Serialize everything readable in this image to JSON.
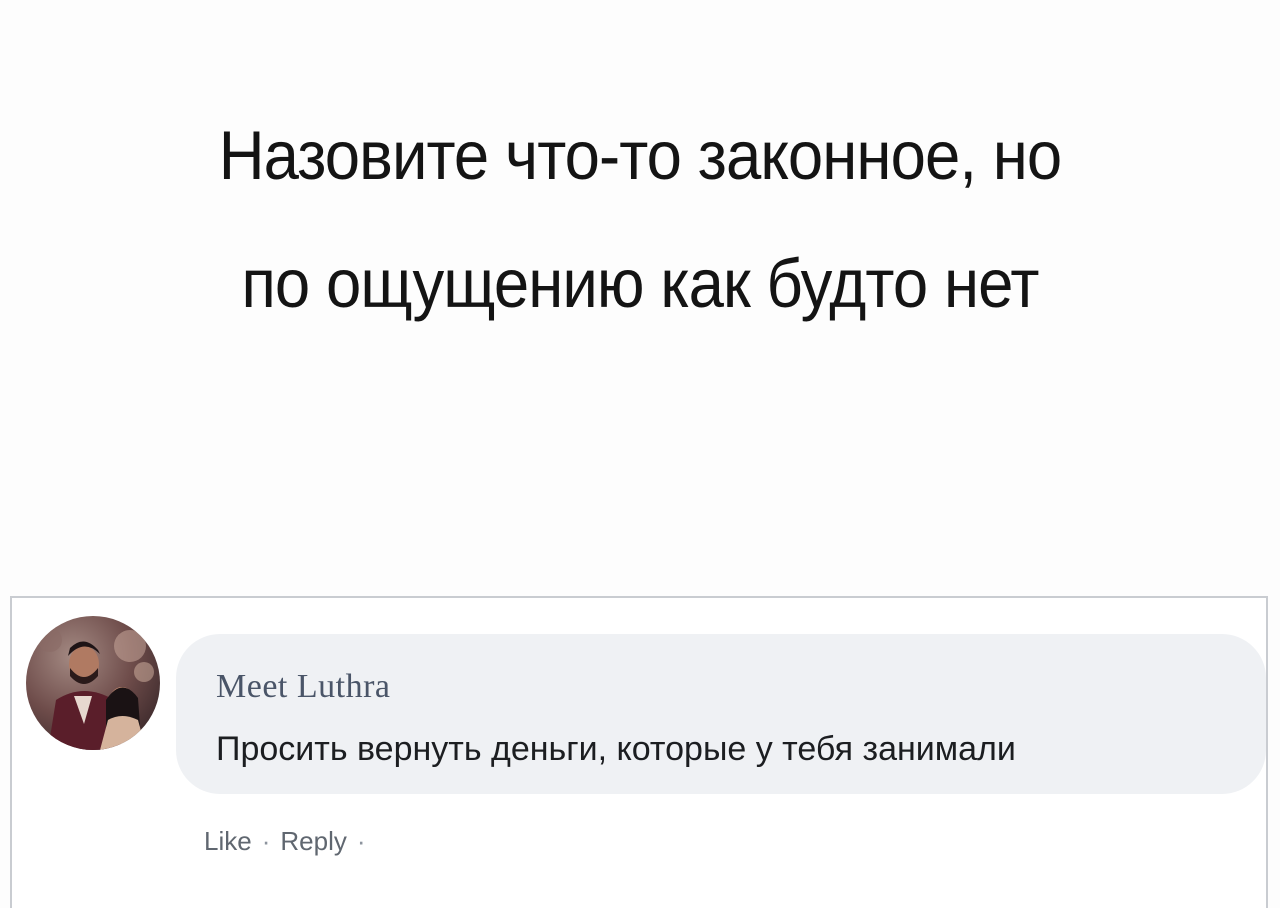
{
  "headline": {
    "line1": "Назовите что-то законное, но",
    "line2": "по ощущению как будто нет"
  },
  "comment": {
    "author": "Meet Luthra",
    "text": "Просить вернуть деньги, которые у тебя занимали",
    "actions": {
      "like": "Like",
      "separator": "·",
      "reply": "Reply"
    }
  },
  "colors": {
    "bubble_bg": "#eff1f4",
    "panel_border": "#c9ccd1",
    "author": "#4a5568",
    "action_text": "#606770"
  }
}
